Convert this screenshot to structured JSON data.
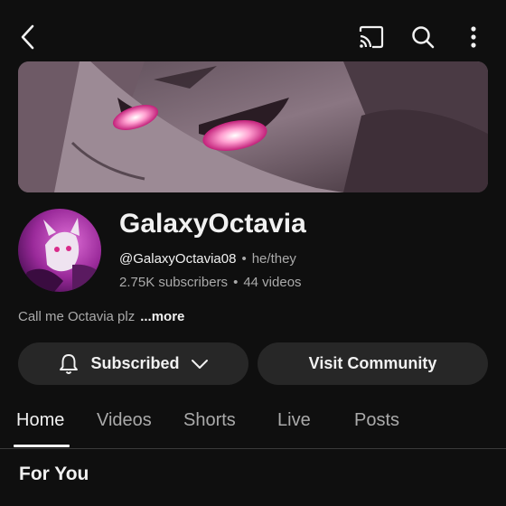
{
  "header": {
    "icons": [
      "back-arrow-icon",
      "cast-icon",
      "search-icon",
      "more-vert-icon"
    ]
  },
  "channel": {
    "name": "GalaxyOctavia",
    "handle": "@GalaxyOctavia08",
    "pronouns": "he/they",
    "subscribers": "2.75K subscribers",
    "videos": "44 videos",
    "separator": "•",
    "description": "Call me Octavia plz",
    "more_label": "...more"
  },
  "actions": {
    "subscribed_label": "Subscribed",
    "community_label": "Visit Community"
  },
  "tabs": [
    {
      "label": "Home",
      "active": true
    },
    {
      "label": "Videos",
      "active": false
    },
    {
      "label": "Shorts",
      "active": false
    },
    {
      "label": "Live",
      "active": false
    },
    {
      "label": "Posts",
      "active": false
    }
  ],
  "section": {
    "title": "For You"
  },
  "colors": {
    "background": "#0f0f0f",
    "button_bg": "#272727",
    "text_primary": "#f1f1f1",
    "text_secondary": "#aaaaaa"
  }
}
